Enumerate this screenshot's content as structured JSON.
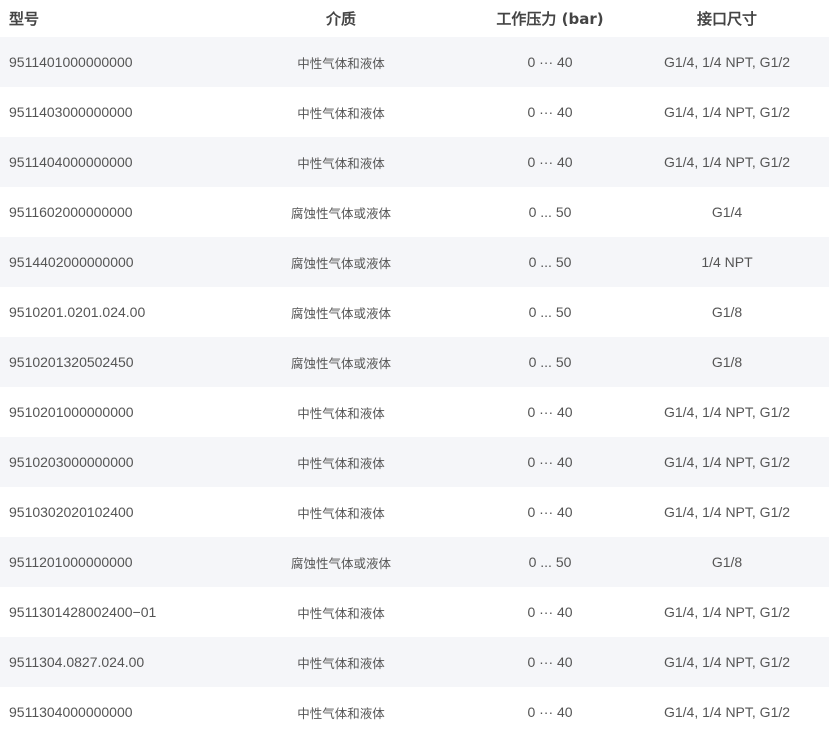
{
  "header": {
    "model": "型号",
    "medium": "介质",
    "pressure": "工作压力 (bar)",
    "port": "接口尺寸"
  },
  "rows": [
    {
      "model": "9511401000000000",
      "medium": "中性气体和液体",
      "pressure": "0 ··· 40",
      "port": "G1/4, 1/4 NPT, G1/2"
    },
    {
      "model": "9511403000000000",
      "medium": "中性气体和液体",
      "pressure": "0 ··· 40",
      "port": "G1/4, 1/4 NPT, G1/2"
    },
    {
      "model": "9511404000000000",
      "medium": "中性气体和液体",
      "pressure": "0 ··· 40",
      "port": "G1/4, 1/4 NPT, G1/2"
    },
    {
      "model": "9511602000000000",
      "medium": "腐蚀性气体或液体",
      "pressure": "0 ... 50",
      "port": "G1/4"
    },
    {
      "model": "9514402000000000",
      "medium": "腐蚀性气体或液体",
      "pressure": "0 ... 50",
      "port": "1/4 NPT"
    },
    {
      "model": "9510201.0201.024.00",
      "medium": "腐蚀性气体或液体",
      "pressure": "0 ... 50",
      "port": "G1/8"
    },
    {
      "model": "9510201320502450",
      "medium": "腐蚀性气体或液体",
      "pressure": "0 ... 50",
      "port": "G1/8"
    },
    {
      "model": "9510201000000000",
      "medium": "中性气体和液体",
      "pressure": "0 ··· 40",
      "port": "G1/4, 1/4 NPT, G1/2"
    },
    {
      "model": "9510203000000000",
      "medium": "中性气体和液体",
      "pressure": "0 ··· 40",
      "port": "G1/4, 1/4 NPT, G1/2"
    },
    {
      "model": "9510302020102400",
      "medium": "中性气体和液体",
      "pressure": "0 ··· 40",
      "port": "G1/4, 1/4 NPT, G1/2"
    },
    {
      "model": "9511201000000000",
      "medium": "腐蚀性气体或液体",
      "pressure": "0 ... 50",
      "port": "G1/8"
    },
    {
      "model": "9511301428002400−01",
      "medium": "中性气体和液体",
      "pressure": "0 ··· 40",
      "port": "G1/4, 1/4 NPT, G1/2"
    },
    {
      "model": "9511304.0827.024.00",
      "medium": "中性气体和液体",
      "pressure": "0 ··· 40",
      "port": "G1/4, 1/4 NPT, G1/2"
    },
    {
      "model": "9511304000000000",
      "medium": "中性气体和液体",
      "pressure": "0 ··· 40",
      "port": "G1/4, 1/4 NPT, G1/2"
    }
  ]
}
